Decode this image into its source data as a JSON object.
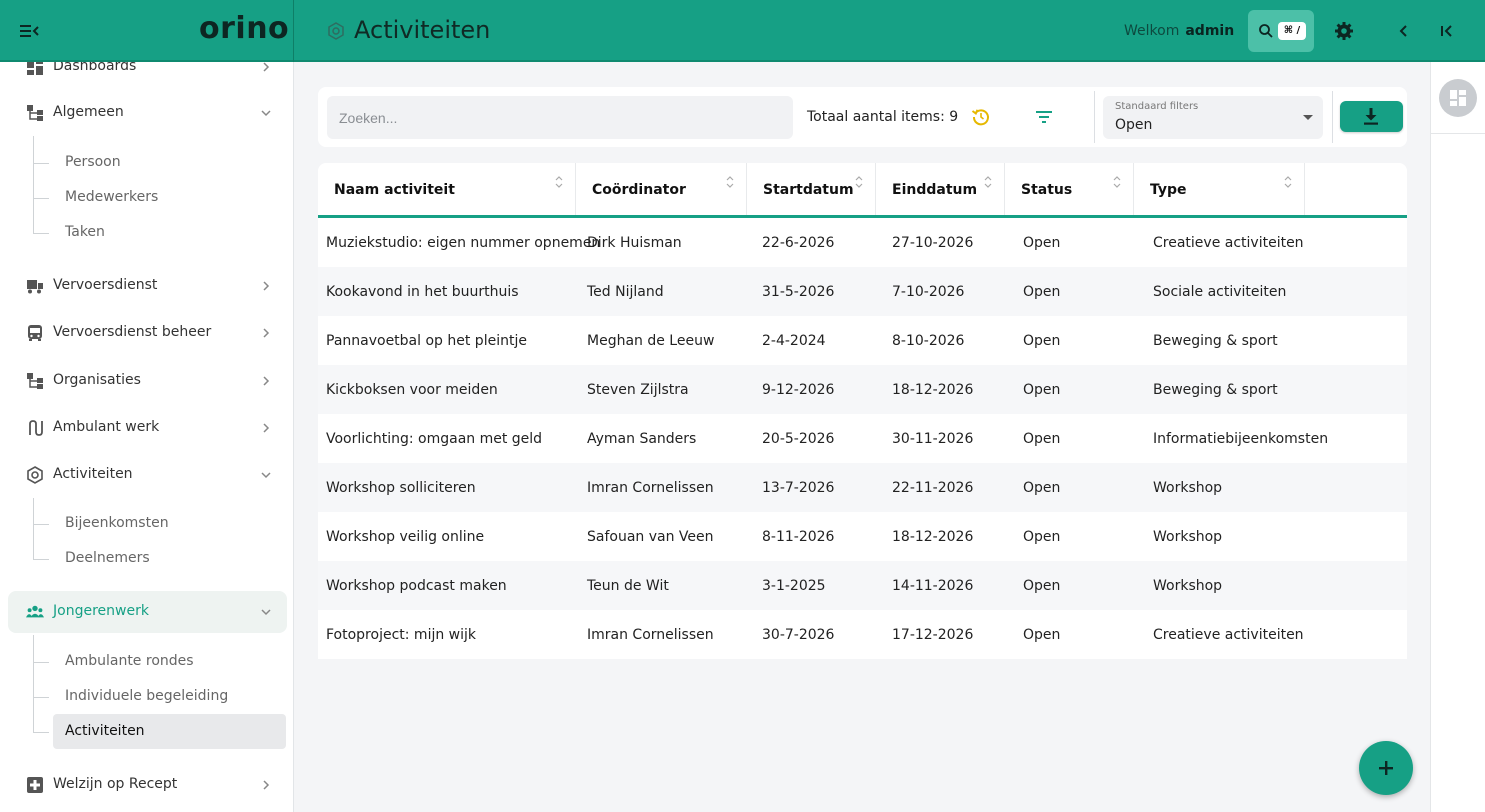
{
  "app": {
    "logo": "orino",
    "page_title": "Activiteiten",
    "welcome": "Welkom",
    "user": "admin",
    "search_shortcut": "⌘ /"
  },
  "sidebar": {
    "items": [
      {
        "label": "Dashboards",
        "icon": "dashboard-icon"
      },
      {
        "label": "Algemeen",
        "icon": "hierarchy-icon",
        "expanded": true
      },
      {
        "label": "Persoon"
      },
      {
        "label": "Medewerkers"
      },
      {
        "label": "Taken"
      },
      {
        "label": "Vervoersdienst",
        "icon": "transport-icon"
      },
      {
        "label": "Vervoersdienst beheer",
        "icon": "bus-icon"
      },
      {
        "label": "Organisaties",
        "icon": "hierarchy-icon"
      },
      {
        "label": "Ambulant werk",
        "icon": "route-icon"
      },
      {
        "label": "Activiteiten",
        "icon": "activity-icon",
        "expanded": true
      },
      {
        "label": "Bijeenkomsten"
      },
      {
        "label": "Deelnemers"
      },
      {
        "label": "Jongerenwerk",
        "icon": "group-icon",
        "expanded": true,
        "active": true
      },
      {
        "label": "Ambulante rondes"
      },
      {
        "label": "Individuele begeleiding"
      },
      {
        "label": "Activiteiten",
        "selected": true
      },
      {
        "label": "Welzijn op Recept",
        "icon": "medical-icon"
      }
    ]
  },
  "toolbar": {
    "search_placeholder": "Zoeken...",
    "total_label": "Totaal aantal items: 9",
    "std_filter_caption": "Standaard filters",
    "std_filter_value": "Open"
  },
  "table": {
    "headers": [
      "Naam activiteit",
      "Coördinator",
      "Startdatum",
      "Einddatum",
      "Status",
      "Type"
    ],
    "rows": [
      [
        "Muziekstudio: eigen nummer opnemen",
        "Dirk Huisman",
        "22-6-2026",
        "27-10-2026",
        "Open",
        "Creatieve activiteiten"
      ],
      [
        "Kookavond in het buurthuis",
        "Ted Nijland",
        "31-5-2026",
        "7-10-2026",
        "Open",
        "Sociale activiteiten"
      ],
      [
        "Pannavoetbal op het pleintje",
        "Meghan de Leeuw",
        "2-4-2024",
        "8-10-2026",
        "Open",
        "Beweging & sport"
      ],
      [
        "Kickboksen voor meiden",
        "Steven Zijlstra",
        "9-12-2026",
        "18-12-2026",
        "Open",
        "Beweging & sport"
      ],
      [
        "Voorlichting: omgaan met geld",
        "Ayman Sanders",
        "20-5-2026",
        "30-11-2026",
        "Open",
        "Informatiebijeenkomsten"
      ],
      [
        "Workshop solliciteren",
        "Imran Cornelissen",
        "13-7-2026",
        "22-11-2026",
        "Open",
        "Workshop"
      ],
      [
        "Workshop veilig online",
        "Safouan van Veen",
        "8-11-2026",
        "18-12-2026",
        "Open",
        "Workshop"
      ],
      [
        "Workshop podcast maken",
        "Teun de Wit",
        "3-1-2025",
        "14-11-2026",
        "Open",
        "Workshop"
      ],
      [
        "Fotoproject: mijn wijk",
        "Imran Cornelissen",
        "30-7-2026",
        "17-12-2026",
        "Open",
        "Creatieve activiteiten"
      ]
    ]
  },
  "colors": {
    "brand": "#16a085",
    "accent_reset": "#e6b800"
  }
}
